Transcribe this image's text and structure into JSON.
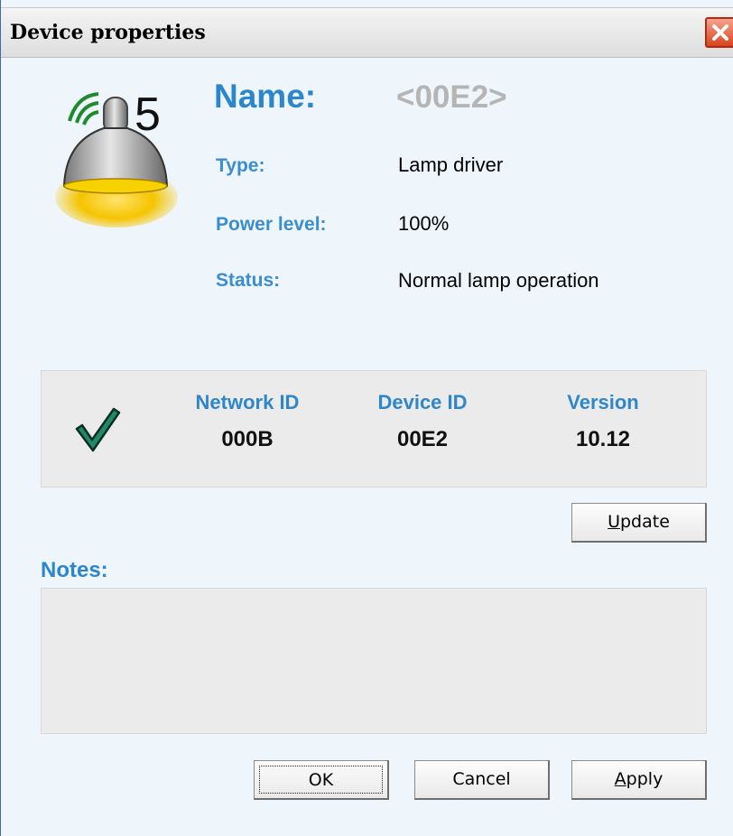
{
  "window": {
    "title": "Device properties",
    "close_icon": "close-x-icon"
  },
  "device": {
    "icon": "wireless-lamp-icon",
    "number": "5",
    "name_label": "Name:",
    "name_value": "<00E2>",
    "properties": [
      {
        "label": "Type:",
        "value": "Lamp driver"
      },
      {
        "label": "Power level:",
        "value": "100%"
      },
      {
        "label": "Status:",
        "value": "Normal lamp operation"
      }
    ]
  },
  "ids": {
    "status_icon": "checkmark-icon",
    "columns": [
      {
        "header": "Network ID",
        "value": "000B"
      },
      {
        "header": "Device ID",
        "value": "00E2"
      },
      {
        "header": "Version",
        "value": "10.12"
      }
    ]
  },
  "buttons": {
    "update": {
      "label": "Update",
      "accel": "U",
      "rest": "pdate"
    },
    "ok": {
      "label": "OK"
    },
    "cancel": {
      "label": "Cancel"
    },
    "apply": {
      "label": "Apply",
      "accel": "A",
      "rest": "pply"
    }
  },
  "notes": {
    "label": "Notes:",
    "value": ""
  },
  "colors": {
    "accent": "#2b86cc",
    "window_bg": "#eef6fc",
    "panel_bg": "#ebebeb",
    "check": "#1f8a6a",
    "lamp_glow": "#f2c200"
  }
}
